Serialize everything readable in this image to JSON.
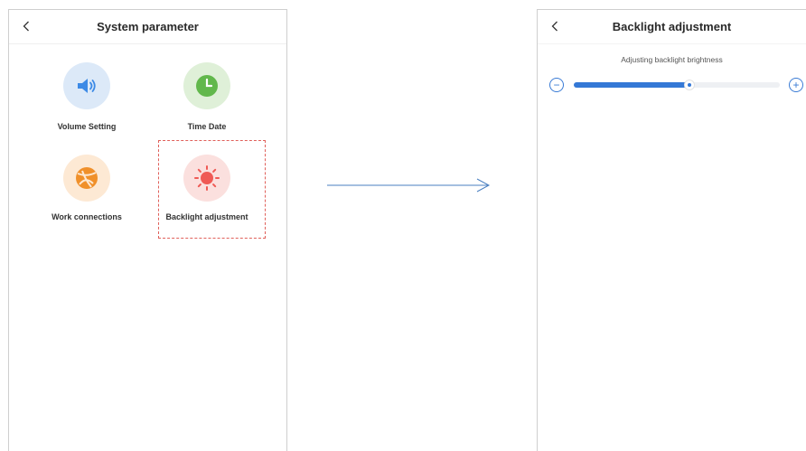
{
  "left_screen": {
    "title": "System parameter",
    "back_icon": "chevron-left-icon",
    "tiles": [
      {
        "label": "Volume Setting",
        "icon": "speaker-icon",
        "bg": "#dce9f8",
        "color": "#3c8ae6"
      },
      {
        "label": "Time Date",
        "icon": "clock-icon",
        "bg": "#dff0d8",
        "color": "#62b84c"
      },
      {
        "label": "Work connections",
        "icon": "network-icon",
        "bg": "#fde9d4",
        "color": "#f0902a"
      },
      {
        "label": "Backlight adjustment",
        "icon": "sun-icon",
        "bg": "#fbe0de",
        "color": "#ef5a55"
      }
    ],
    "highlight_color": "#e0605a"
  },
  "arrow": {
    "color": "#4a7fc1"
  },
  "right_screen": {
    "title": "Backlight adjustment",
    "back_icon": "chevron-left-icon",
    "subtitle": "Adjusting backlight brightness",
    "slider": {
      "value_fraction": 0.56,
      "decrease_symbol": "−",
      "increase_symbol": "+"
    },
    "accent": "#3478d6"
  }
}
